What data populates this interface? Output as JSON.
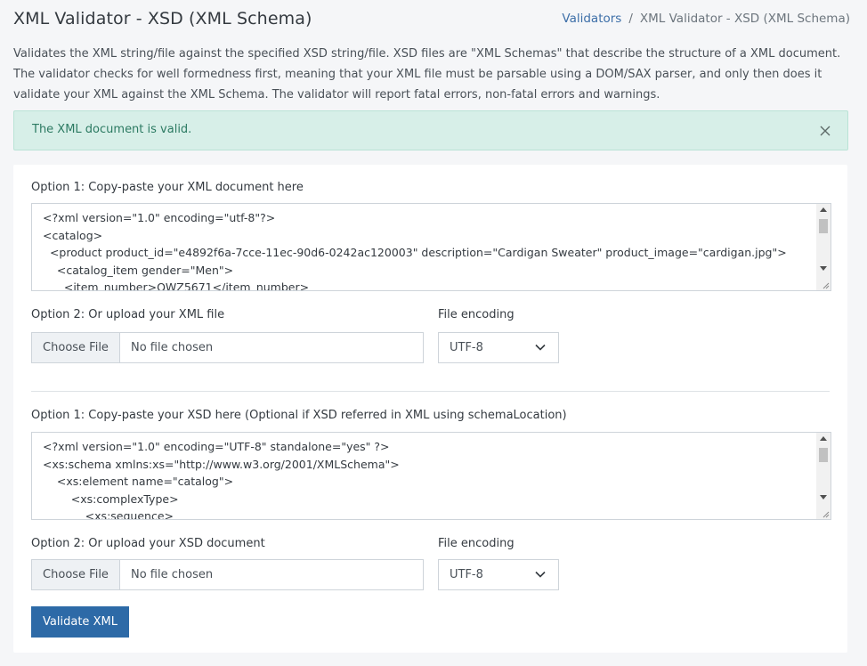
{
  "header": {
    "title": "XML Validator - XSD (XML Schema)",
    "breadcrumb": {
      "link": "Validators",
      "separator": "/",
      "current": "XML Validator - XSD (XML Schema)"
    }
  },
  "description": "Validates the XML string/file against the specified XSD string/file. XSD files are \"XML Schemas\" that describe the structure of a XML document. The validator checks for well formedness first, meaning that your XML file must be parsable using a DOM/SAX parser, and only then does it validate your XML against the XML Schema. The validator will report fatal errors, non-fatal errors and warnings.",
  "alert": {
    "text": "The XML document is valid.",
    "close_icon": "close-icon",
    "color": "#d7efe8"
  },
  "xml_section": {
    "paste_label": "Option 1: Copy-paste your XML document here",
    "code": "<?xml version=\"1.0\" encoding=\"utf-8\"?>\n<catalog>\n  <product product_id=\"e4892f6a-7cce-11ec-90d6-0242ac120003\" description=\"Cardigan Sweater\" product_image=\"cardigan.jpg\">\n    <catalog_item gender=\"Men\">\n      <item_number>QWZ5671</item_number>",
    "upload_label": "Option 2: Or upload your XML file",
    "choose_button": "Choose File",
    "file_name": "No file chosen",
    "encoding_label": "File encoding",
    "encoding_value": "UTF-8"
  },
  "xsd_section": {
    "paste_label": "Option 1: Copy-paste your XSD here (Optional if XSD referred in XML using schemaLocation)",
    "code": "<?xml version=\"1.0\" encoding=\"UTF-8\" standalone=\"yes\" ?>\n<xs:schema xmlns:xs=\"http://www.w3.org/2001/XMLSchema\">\n    <xs:element name=\"catalog\">\n        <xs:complexType>\n            <xs:sequence>",
    "upload_label": "Option 2: Or upload your XSD document",
    "choose_button": "Choose File",
    "file_name": "No file chosen",
    "encoding_label": "File encoding",
    "encoding_value": "UTF-8"
  },
  "actions": {
    "validate_label": "Validate XML",
    "button_color": "#2d6aa7"
  }
}
